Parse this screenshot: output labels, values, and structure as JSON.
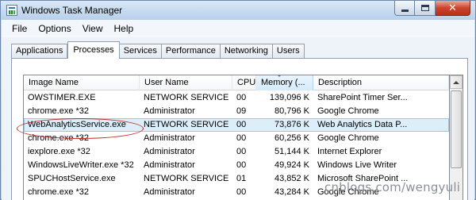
{
  "window": {
    "title": "Windows Task Manager"
  },
  "menu": [
    "File",
    "Options",
    "View",
    "Help"
  ],
  "tabs": [
    {
      "label": "Applications",
      "active": false
    },
    {
      "label": "Processes",
      "active": true
    },
    {
      "label": "Services",
      "active": false
    },
    {
      "label": "Performance",
      "active": false
    },
    {
      "label": "Networking",
      "active": false
    },
    {
      "label": "Users",
      "active": false
    }
  ],
  "columns": [
    "Image Name",
    "User Name",
    "CPU",
    "Memory (...",
    "Description"
  ],
  "sort_column": "Memory (...",
  "rows": [
    {
      "name": "OWSTIMER.EXE",
      "user": "NETWORK SERVICE",
      "cpu": "00",
      "mem": "139,096 K",
      "desc": "SharePoint Timer Ser..."
    },
    {
      "name": "chrome.exe *32",
      "user": "Administrator",
      "cpu": "09",
      "mem": "80,796 K",
      "desc": "Google Chrome"
    },
    {
      "name": "WebAnalyticsService.exe",
      "user": "NETWORK SERVICE",
      "cpu": "00",
      "mem": "73,876 K",
      "desc": "Web Analytics Data P..."
    },
    {
      "name": "chrome.exe *32",
      "user": "Administrator",
      "cpu": "00",
      "mem": "60,256 K",
      "desc": "Google Chrome"
    },
    {
      "name": "iexplore.exe *32",
      "user": "Administrator",
      "cpu": "00",
      "mem": "51,144 K",
      "desc": "Internet Explorer"
    },
    {
      "name": "WindowsLiveWriter.exe *32",
      "user": "Administrator",
      "cpu": "00",
      "mem": "49,924 K",
      "desc": "Windows Live Writer"
    },
    {
      "name": "SPUCHostService.exe",
      "user": "NETWORK SERVICE",
      "cpu": "01",
      "mem": "43,852 K",
      "desc": "Microsoft SharePoint ..."
    },
    {
      "name": "chrome.exe *32",
      "user": "Administrator",
      "cpu": "00",
      "mem": "43,284 K",
      "desc": "Google Chrome"
    }
  ],
  "selected_row": 2,
  "watermark": "cnblogs.com/wengyuli",
  "colors": {
    "highlight_ellipse": "#c0281e",
    "selection": "#ddeefb",
    "close_button": "#c9452f"
  }
}
